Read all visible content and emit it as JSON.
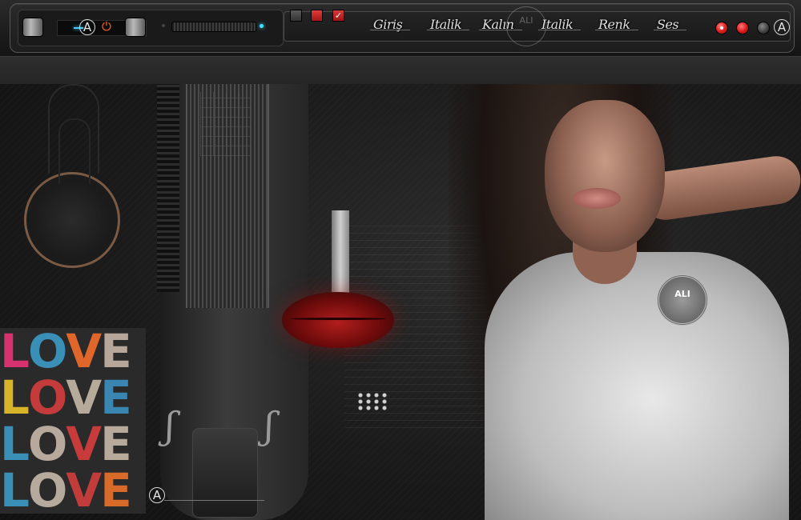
{
  "toolbar": {
    "menu": [
      {
        "label": "Giriş"
      },
      {
        "label": "Italik"
      },
      {
        "label": "Kalın"
      },
      {
        "label": "Italik"
      },
      {
        "label": "Renk"
      },
      {
        "label": "Ses"
      }
    ],
    "watermark_text": "ALI"
  },
  "hero": {
    "love_rows": [
      [
        "L",
        "O",
        "V",
        "E"
      ],
      [
        "L",
        "O",
        "V",
        "E"
      ],
      [
        "L",
        "O",
        "V",
        "E"
      ],
      [
        "L",
        "O",
        "V",
        "E"
      ]
    ],
    "love_colors": [
      [
        "#d6326e",
        "#3a8fb7",
        "#e0662a",
        "#b7a79a"
      ],
      [
        "#d8b42a",
        "#c43b3b",
        "#b6aa9a",
        "#3a86b3"
      ],
      [
        "#3b8fb7",
        "#b7aa9c",
        "#c73b3b",
        "#b7aa9a"
      ],
      [
        "#3a8fb7",
        "#b6aa9c",
        "#c23c3c",
        "#d86a2a"
      ]
    ],
    "seal_text": "ALI"
  },
  "colors": {
    "accent_blue": "#4cc8ff",
    "power_orange": "#ff6a1a",
    "button_red": "#d81818"
  },
  "icons": {
    "logo": "A-circle-logo-icon",
    "power": "power-icon",
    "check": "check-icon"
  }
}
